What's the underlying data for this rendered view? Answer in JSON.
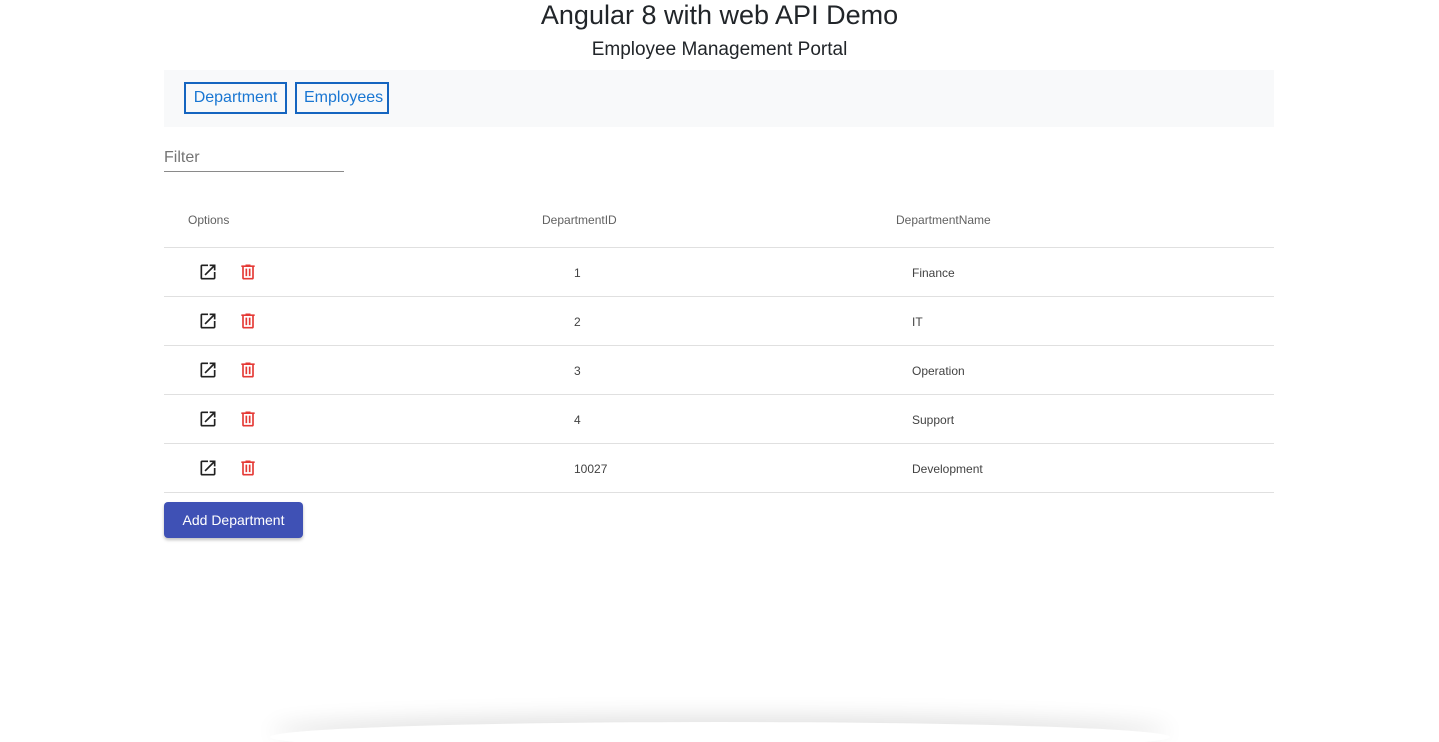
{
  "header": {
    "title": "Angular 8 with web API Demo",
    "subtitle": "Employee Management Portal"
  },
  "nav": {
    "department_label": "Department",
    "employees_label": "Employees"
  },
  "filter": {
    "placeholder": "Filter",
    "value": ""
  },
  "table": {
    "columns": [
      "Options",
      "DepartmentID",
      "DepartmentName"
    ],
    "rows": [
      {
        "id": "1",
        "name": "Finance"
      },
      {
        "id": "2",
        "name": "IT"
      },
      {
        "id": "3",
        "name": "Operation"
      },
      {
        "id": "4",
        "name": "Support"
      },
      {
        "id": "10027",
        "name": "Development"
      }
    ],
    "row_icons": {
      "edit": "open-in-new-icon",
      "delete": "trash-icon"
    }
  },
  "actions": {
    "add_label": "Add Department"
  },
  "colors": {
    "nav_accent": "#1976d2",
    "delete_icon": "#e53935",
    "primary_button": "#3f51b5"
  }
}
